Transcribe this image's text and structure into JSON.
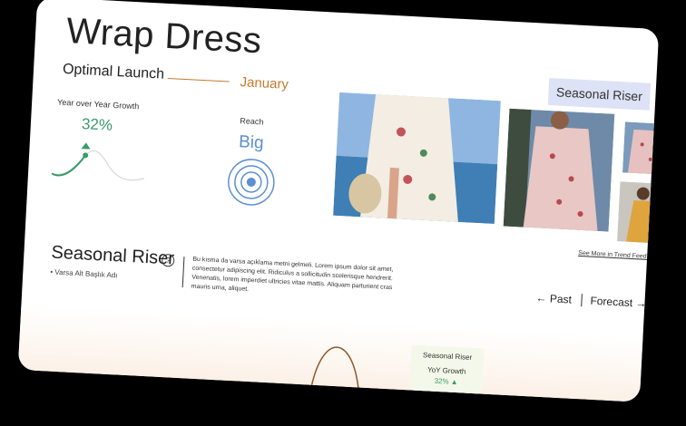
{
  "header": {
    "title": "Wrap Dress",
    "optimal_label": "Optimal Launch",
    "optimal_month": "January",
    "badge": "Seasonal Riser"
  },
  "metrics": {
    "yoy_label": "Year over Year Growth",
    "yoy_value": "32%",
    "reach_label": "Reach",
    "reach_value": "Big"
  },
  "gallery": {
    "link": "See More in Trend Feed →"
  },
  "section": {
    "title": "Seasonal Riser",
    "help_icon": "?",
    "sub_item": "• Varsa Alt Başlık Adı",
    "description": "Bu kısma da varsa açıklama metni gelmeli. Lorem ipsum dolor sit amet, consectetur adipiscing elit. Ridiculus a sollicitudin scelerisque hendrerit. Venenatis, lorem imperdiet ultricies vitae mattis. Aliquam parturient cras mauris urna, aliquet."
  },
  "nav": {
    "past": "←  Past",
    "forecast": "Forecast  →"
  },
  "bottom_card": {
    "title": "Seasonal Riser",
    "sub": "YoY Growth",
    "value": "32% ▲"
  },
  "colors": {
    "orange": "#c47a2c",
    "green": "#3a9b6a",
    "blue": "#5b8fd1",
    "badge_bg": "#dde2f6"
  },
  "icons": {
    "growth": "growth-wave-icon",
    "reach": "target-rings-icon",
    "help": "question-circle-icon"
  }
}
